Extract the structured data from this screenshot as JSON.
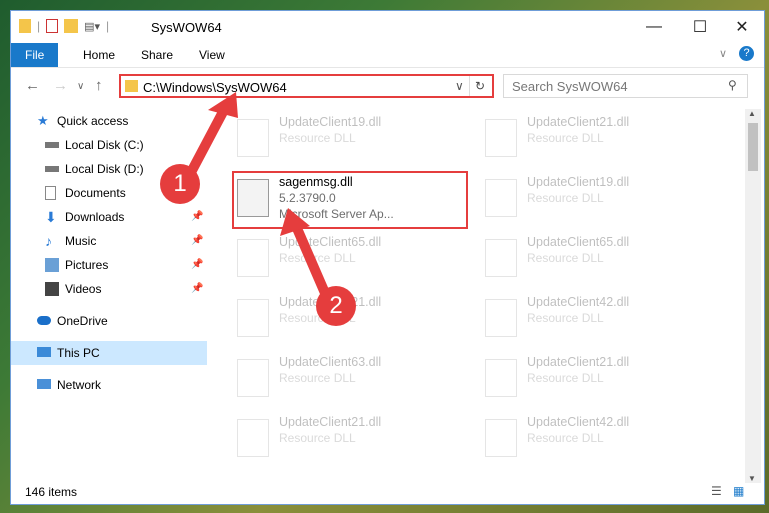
{
  "window": {
    "title": "SysWOW64",
    "minimize": "—",
    "maximize": "☐",
    "close": "✕"
  },
  "ribbon": {
    "tabs": [
      "File",
      "Home",
      "Share",
      "View"
    ]
  },
  "address": {
    "path": "C:\\Windows\\SysWOW64"
  },
  "search": {
    "placeholder": "Search SysWOW64"
  },
  "sidebar": {
    "items": [
      {
        "label": "Quick access",
        "icon": "star-icon"
      },
      {
        "label": "Local Disk (C:)",
        "icon": "drive-icon"
      },
      {
        "label": "Local Disk (D:)",
        "icon": "drive-icon"
      },
      {
        "label": "Documents",
        "icon": "documents-icon"
      },
      {
        "label": "Downloads",
        "icon": "download-icon"
      },
      {
        "label": "Music",
        "icon": "music-icon"
      },
      {
        "label": "Pictures",
        "icon": "pictures-icon"
      },
      {
        "label": "Videos",
        "icon": "videos-icon"
      },
      {
        "label": "OneDrive",
        "icon": "cloud-icon"
      },
      {
        "label": "This PC",
        "icon": "computer-icon"
      },
      {
        "label": "Network",
        "icon": "network-icon"
      }
    ]
  },
  "files": {
    "highlighted": {
      "name": "sagenmsg.dll",
      "version": "5.2.3790.0",
      "description": "Microsoft Server Ap..."
    },
    "left_column": [
      {
        "name": "UpdateClient19.dll",
        "type": "Resource DLL"
      },
      {
        "name": "UpdateClient65.dll",
        "type": "Resource DLL"
      },
      {
        "name": "UpdateClient21.dll",
        "type": "Resource DLL"
      },
      {
        "name": "UpdateClient63.dll",
        "type": "Resource DLL"
      },
      {
        "name": "UpdateClient21.dll",
        "type": "Resource DLL"
      }
    ],
    "right_column": [
      {
        "name": "UpdateClient21.dll",
        "type": "Resource DLL"
      },
      {
        "name": "UpdateClient19.dll",
        "type": "Resource DLL"
      },
      {
        "name": "UpdateClient65.dll",
        "type": "Resource DLL"
      },
      {
        "name": "UpdateClient42.dll",
        "type": "Resource DLL"
      },
      {
        "name": "UpdateClient21.dll",
        "type": "Resource DLL"
      },
      {
        "name": "UpdateClient42.dll",
        "type": "Resource DLL"
      }
    ]
  },
  "status": {
    "count": "146 items"
  },
  "annotations": {
    "step1": "1",
    "step2": "2"
  },
  "colors": {
    "accent": "#1979ca",
    "highlight": "#e53d3d",
    "selected": "#cce8ff"
  }
}
